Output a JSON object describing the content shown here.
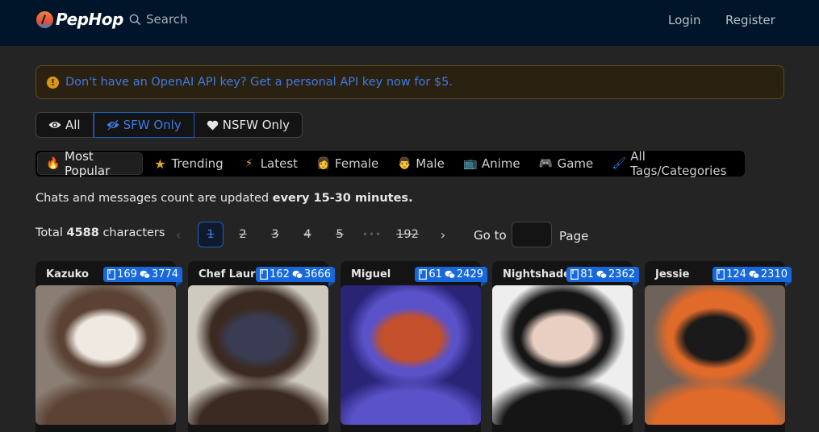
{
  "header": {
    "brand": "PepHop",
    "search_label": "Search",
    "login": "Login",
    "register": "Register"
  },
  "alert": {
    "icon": "exclamation-circle-icon",
    "text": "Don't have an OpenAI API key? Get a personal API key now for $5."
  },
  "content_filter": {
    "options": [
      {
        "label": "All",
        "icon": "eye-icon",
        "active": false
      },
      {
        "label": "SFW Only",
        "icon": "eye-slash-icon",
        "active": true
      },
      {
        "label": "NSFW Only",
        "icon": "heart-icon",
        "active": false
      }
    ]
  },
  "category_tabs": [
    {
      "label": "Most Popular",
      "icon": "fire-icon",
      "emoji": "🔥",
      "active": true
    },
    {
      "label": "Trending",
      "icon": "star-icon",
      "emoji": "★",
      "active": false
    },
    {
      "label": "Latest",
      "icon": "lightning-icon",
      "emoji": "⚡",
      "active": false
    },
    {
      "label": "Female",
      "icon": "female-face-icon",
      "emoji": "👩",
      "active": false
    },
    {
      "label": "Male",
      "icon": "male-face-icon",
      "emoji": "👨",
      "active": false
    },
    {
      "label": "Anime",
      "icon": "tv-icon",
      "emoji": "📺",
      "active": false
    },
    {
      "label": "Game",
      "icon": "gamepad-icon",
      "emoji": "🎮",
      "active": false
    },
    {
      "label": "All Tags/Categories",
      "icon": "brush-icon",
      "emoji": "🖌",
      "active": false
    }
  ],
  "info": {
    "prefix": "Chats and messages count are updated ",
    "bold": "every 15-30 minutes."
  },
  "total": {
    "prefix": "Total ",
    "count": "4588",
    "suffix": " characters"
  },
  "pagination": {
    "pages": [
      "1",
      "2",
      "3",
      "4",
      "5"
    ],
    "current": "1",
    "ellipsis": "•••",
    "last": "192",
    "goto_label": "Go to",
    "goto_value": "",
    "page_label": "Page"
  },
  "characters": [
    {
      "name": "Kazuko",
      "chats": "169",
      "messages": "3774",
      "palette": [
        "#8a7d74",
        "#5b4234",
        "#efe9e2"
      ]
    },
    {
      "name": "Chef Lauren",
      "chats": "162",
      "messages": "3666",
      "palette": [
        "#cfcac0",
        "#3b2a22",
        "#393c52"
      ]
    },
    {
      "name": "Miguel",
      "chats": "61",
      "messages": "2429",
      "palette": [
        "#2a2477",
        "#5a52c8",
        "#c3502a"
      ]
    },
    {
      "name": "Nightshade",
      "chats": "81",
      "messages": "2362",
      "palette": [
        "#eeeeee",
        "#151515",
        "#e8cfc2"
      ]
    },
    {
      "name": "Jessie",
      "chats": "124",
      "messages": "2310",
      "palette": [
        "#6e625a",
        "#e06a2a",
        "#1a1a1a"
      ]
    }
  ]
}
